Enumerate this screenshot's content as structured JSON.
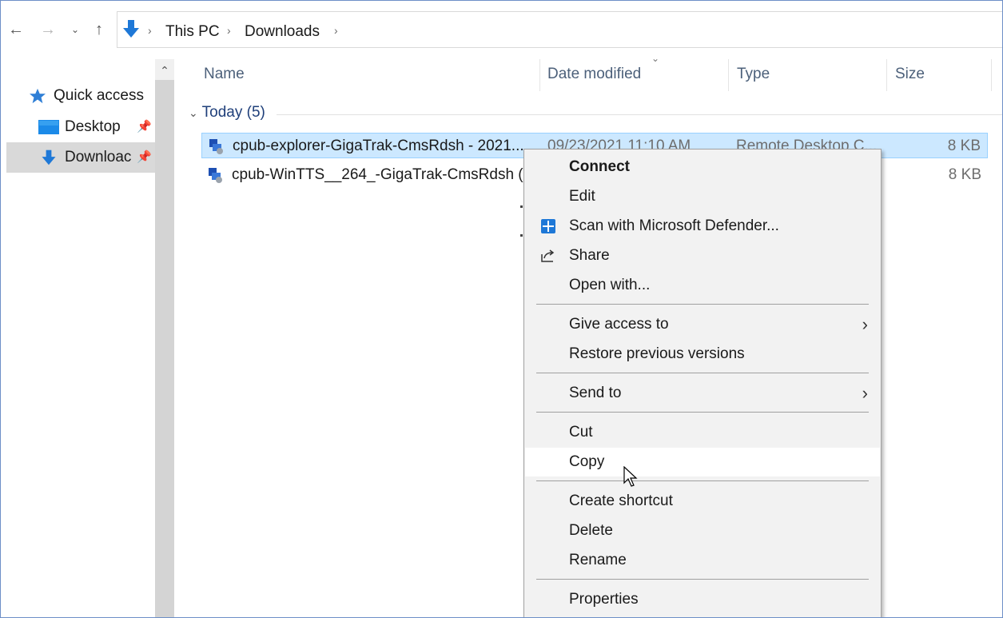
{
  "toolbar": {
    "back_icon": "back-arrow-icon",
    "forward_icon": "forward-arrow-icon",
    "recent_icon": "chevron-down-icon",
    "up_icon": "up-arrow-icon"
  },
  "address": {
    "location_icon": "downloads-arrow-icon",
    "crumbs": [
      "This PC",
      "Downloads"
    ]
  },
  "nav": {
    "items": [
      {
        "label": "Quick access",
        "icon": "star-icon"
      },
      {
        "label": "Desktop",
        "icon": "desktop-icon"
      },
      {
        "label": "Downloac",
        "icon": "downloads-arrow-icon"
      }
    ]
  },
  "columns": {
    "name": "Name",
    "date": "Date modified",
    "type": "Type",
    "size": "Size"
  },
  "group": {
    "label": "Today (5)"
  },
  "files": [
    {
      "name": "cpub-explorer-GigaTrak-CmsRdsh - 2021...",
      "date": "09/23/2021 11:10 AM",
      "type": "Remote Desktop C...",
      "size": "8 KB"
    },
    {
      "name": "cpub-WinTTS__264_-GigaTrak-CmsRdsh (...",
      "date": "",
      "type": "",
      "size": "8 KB"
    }
  ],
  "context_menu": {
    "items": [
      {
        "label": "Connect"
      },
      {
        "label": "Edit"
      },
      {
        "label": "Scan with Microsoft Defender...",
        "icon": "defender-shield-icon"
      },
      {
        "label": "Share",
        "icon": "share-icon"
      },
      {
        "label": "Open with..."
      },
      {
        "label": "Give access to"
      },
      {
        "label": "Restore previous versions"
      },
      {
        "label": "Send to"
      },
      {
        "label": "Cut"
      },
      {
        "label": "Copy"
      },
      {
        "label": "Create shortcut"
      },
      {
        "label": "Delete"
      },
      {
        "label": "Rename"
      },
      {
        "label": "Properties"
      }
    ],
    "hovered": "Copy"
  },
  "colors": {
    "selection_bg": "#cce8ff",
    "selection_border": "#99d1ff",
    "accent_blue": "#1e78d7",
    "menu_bg": "#f2f2f2"
  }
}
